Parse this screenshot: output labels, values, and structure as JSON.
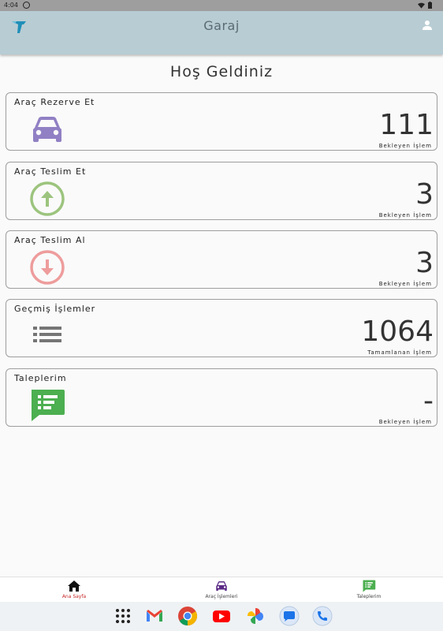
{
  "status_bar": {
    "time": "4:04"
  },
  "app_bar": {
    "title": "Garaj"
  },
  "welcome": "Hoş Geldiniz",
  "cards": [
    {
      "title": "Araç Rezerve Et",
      "count": "111",
      "subtitle": "Bekleyen İşlem",
      "icon": "car-icon",
      "color": "#9180c4"
    },
    {
      "title": "Araç Teslim Et",
      "count": "3",
      "subtitle": "Bekleyen İşlem",
      "icon": "arrow-up-circle-icon",
      "color": "#9cc47e"
    },
    {
      "title": "Araç Teslim Al",
      "count": "3",
      "subtitle": "Bekleyen İşlem",
      "icon": "arrow-down-circle-icon",
      "color": "#ee9c9c"
    },
    {
      "title": "Geçmiş İşlemler",
      "count": "1064",
      "subtitle": "Tamamlanan İşlem",
      "icon": "list-icon",
      "color": "#757575"
    },
    {
      "title": "Taleplerim",
      "count": "-",
      "subtitle": "Bekleyen İşlem",
      "icon": "chat-list-icon",
      "color": "#4caf50"
    }
  ],
  "bottom_nav": [
    {
      "label": "Ana Sayfa",
      "icon": "home-icon",
      "active": true
    },
    {
      "label": "Araç İşlemleri",
      "icon": "car-icon",
      "active": false
    },
    {
      "label": "Taleplerim",
      "icon": "chat-list-icon",
      "active": false
    }
  ],
  "dock": [
    "apps-icon",
    "gmail-icon",
    "chrome-icon",
    "youtube-icon",
    "photos-icon",
    "messages-icon",
    "phone-icon"
  ]
}
